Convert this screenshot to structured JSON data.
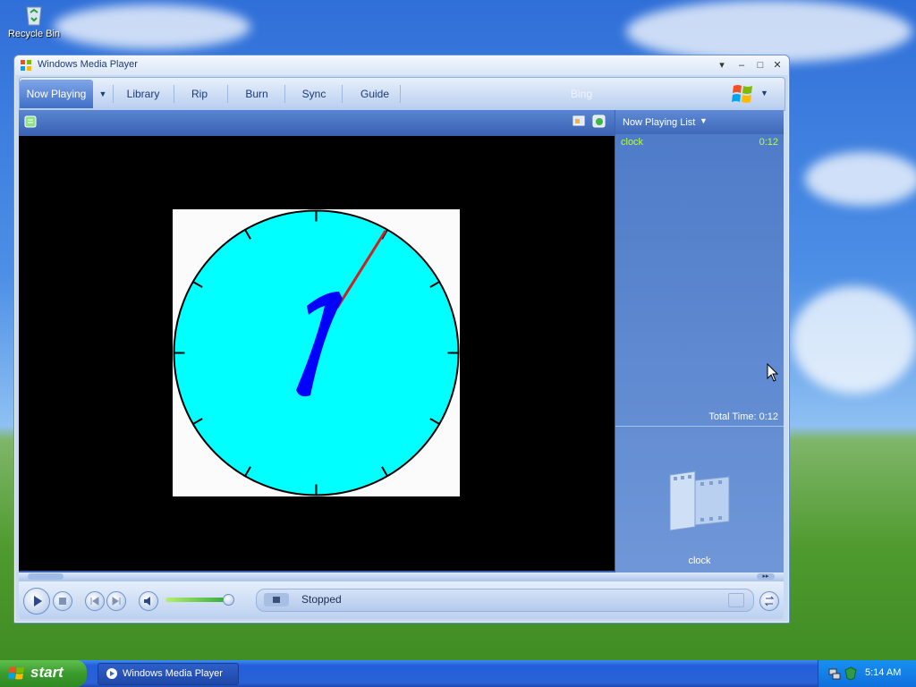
{
  "desktop": {
    "recycle_bin_label": "Recycle Bin"
  },
  "window": {
    "title": "Windows Media Player",
    "controls": {
      "minimize": "▾",
      "restore": "▫",
      "maximize": "□",
      "close": "✕"
    }
  },
  "tabs": [
    {
      "label": "Now Playing",
      "active": true
    },
    {
      "label": "Library"
    },
    {
      "label": "Rip"
    },
    {
      "label": "Burn"
    },
    {
      "label": "Sync"
    },
    {
      "label": "Guide"
    },
    {
      "label": "Bing"
    }
  ],
  "playlist": {
    "header_label": "Now Playing List",
    "items": [
      {
        "title": "clock",
        "duration": "0:12"
      }
    ],
    "total_time_label": "Total Time: 0:12",
    "album_caption": "clock"
  },
  "video": {
    "clock": {
      "face_color": "#00ffff",
      "hour_hand_color": "#0000ff",
      "minute_hand_color": "#cc2222"
    }
  },
  "playback": {
    "status": "Stopped"
  },
  "taskbar": {
    "start_label": "start",
    "task_label": "Windows Media Player",
    "clock": "5:14 AM"
  },
  "colors": {
    "accent": "#3b64b4",
    "playlist_item": "#b8ff3c"
  }
}
